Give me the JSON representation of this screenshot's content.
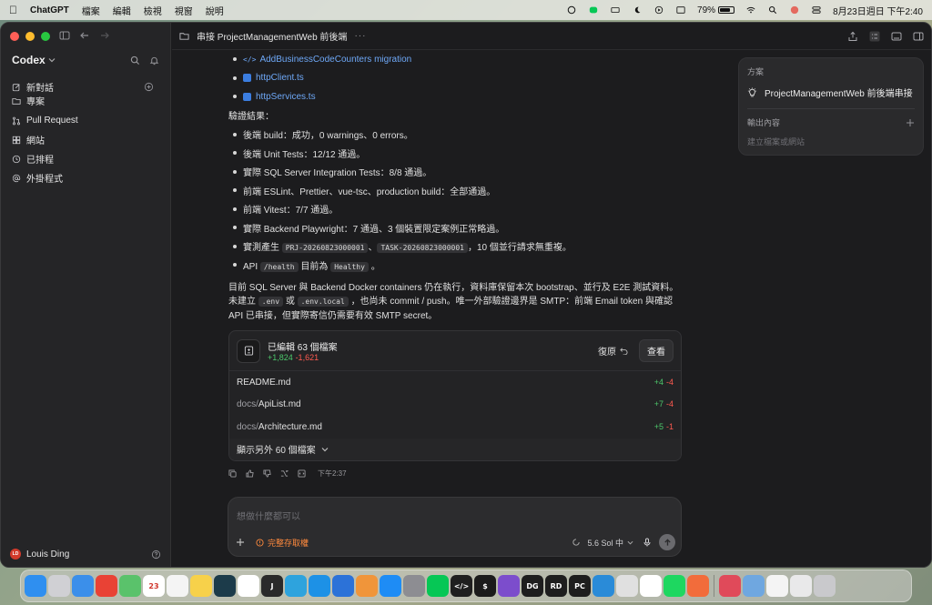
{
  "menubar": {
    "app_name": "ChatGPT",
    "menus": [
      "檔案",
      "編輯",
      "檢視",
      "視窗",
      "說明"
    ],
    "battery": "79%",
    "battery_level": 0.79,
    "datetime": "8月23日週日 下午2:40"
  },
  "sidebar": {
    "title": "Codex",
    "items": [
      {
        "label": "新對話",
        "icon": "compose-icon"
      },
      {
        "label": "專案",
        "icon": "folder-icon"
      },
      {
        "label": "Pull Request",
        "icon": "pull-request-icon"
      },
      {
        "label": "網站",
        "icon": "grid-icon"
      },
      {
        "label": "已排程",
        "icon": "clock-icon"
      },
      {
        "label": "外掛程式",
        "icon": "at-icon"
      }
    ],
    "user": {
      "name": "Louis Ding",
      "initials": "LD"
    }
  },
  "topbar": {
    "title": "串接 ProjectManagementWeb 前後端",
    "more": "···"
  },
  "conversation": {
    "files": [
      {
        "name": "AddBusinessCodeCounters migration",
        "kind": "code"
      },
      {
        "name": "httpClient.ts",
        "kind": "ts"
      },
      {
        "name": "httpServices.ts",
        "kind": "ts"
      }
    ],
    "verify_label": "驗證結果：",
    "results": [
      {
        "text": "後端 build：成功，0 warnings、0 errors。"
      },
      {
        "text": "後端 Unit Tests：12/12 通過。"
      },
      {
        "text": "實際 SQL Server Integration Tests：8/8 通過。"
      },
      {
        "text": "前端 ESLint、Prettier、vue-tsc、production build：全部通過。"
      },
      {
        "text": "前端 Vitest：7/7 通過。"
      },
      {
        "text": "實際 Backend Playwright：7 通過、3 個裝置限定案例正常略過。"
      }
    ],
    "result_codes": {
      "prefix": "實測產生",
      "code1": "PRJ-20260823000001",
      "sep": "、",
      "code2": "TASK-20260823000001",
      "suffix": "，10 個並行請求無重複。"
    },
    "result_api": {
      "prefix": "API",
      "code1": "/health",
      "mid": "目前為",
      "code2": "Healthy",
      "suffix": "。"
    },
    "paragraph": {
      "part1": "目前 SQL Server 與 Backend Docker containers 仍在執行，資料庫保留本次 bootstrap、並行及 E2E 測試資料。未建立",
      "code1": ".env",
      "part2": "或",
      "code2": ".env.local",
      "part3": "，也尚未 commit / push。唯一外部驗證邊界是 SMTP：前端 Email token 與確認 API 已串接，但實際寄信仍需要有效 SMTP secret。"
    },
    "card": {
      "title": "已編輯 63 個檔案",
      "additions": "+1,824",
      "deletions": "-1,621",
      "restore": "復原",
      "view": "查看",
      "files": [
        {
          "dir": "",
          "name": "README.md",
          "add": "+4",
          "del": "-4"
        },
        {
          "dir": "docs/",
          "name": "ApiList.md",
          "add": "+7",
          "del": "-4"
        },
        {
          "dir": "docs/",
          "name": "Architecture.md",
          "add": "+5",
          "del": "-1"
        }
      ],
      "show_more": "顯示另外 60 個檔案"
    },
    "timestamp": "下午2:37"
  },
  "composer": {
    "placeholder": "想做什麼都可以",
    "permission": "完整存取權",
    "model": "5.6 Sol 中"
  },
  "right_panel": {
    "plan_label": "方案",
    "plan_item": "ProjectManagementWeb 前後端串接",
    "output_label": "輸出內容",
    "output_hint": "建立檔案或網站"
  },
  "dock": {
    "apps": [
      {
        "name": "Finder",
        "color": "#2f8ff0",
        "glyph": ""
      },
      {
        "name": "Launchpad",
        "color": "#d0d0d4",
        "glyph": ""
      },
      {
        "name": "Mail",
        "color": "#3b8fea",
        "glyph": ""
      },
      {
        "name": "Chrome",
        "color": "#e94235",
        "glyph": ""
      },
      {
        "name": "Maps",
        "color": "#5ac26b",
        "glyph": ""
      },
      {
        "name": "Calendar",
        "color": "#ffffff",
        "glyph": "23"
      },
      {
        "name": "Reminders",
        "color": "#f4f4f4",
        "glyph": ""
      },
      {
        "name": "Notes",
        "color": "#f7d14a",
        "glyph": ""
      },
      {
        "name": "Stocks",
        "color": "#1c3b4a",
        "glyph": ""
      },
      {
        "name": "Home",
        "color": "#ffffff",
        "glyph": ""
      },
      {
        "name": "J",
        "color": "#2a2a2a",
        "glyph": "J"
      },
      {
        "name": "Telegram",
        "color": "#2ea3dd",
        "glyph": ""
      },
      {
        "name": "Docker",
        "color": "#1d91e6",
        "glyph": ""
      },
      {
        "name": "App",
        "color": "#2c72d8",
        "glyph": ""
      },
      {
        "name": "Sublime",
        "color": "#f0953a",
        "glyph": ""
      },
      {
        "name": "App Store",
        "color": "#1e8cf5",
        "glyph": ""
      },
      {
        "name": "Settings",
        "color": "#8d8d92",
        "glyph": ""
      },
      {
        "name": "LINE",
        "color": "#06c755",
        "glyph": ""
      },
      {
        "name": "Code",
        "color": "#1f1f1f",
        "glyph": "</>"
      },
      {
        "name": "Terminal",
        "color": "#1b1b1b",
        "glyph": "$"
      },
      {
        "name": "Obsidian",
        "color": "#7c4dcc",
        "glyph": ""
      },
      {
        "name": "DataGrip",
        "color": "#1e1e1e",
        "glyph": "DG"
      },
      {
        "name": "Rider",
        "color": "#1e1e1e",
        "glyph": "RD"
      },
      {
        "name": "PyCharm",
        "color": "#1e1e1e",
        "glyph": "PC"
      },
      {
        "name": "VS Code",
        "color": "#2a8bd8",
        "glyph": ""
      },
      {
        "name": "Preview",
        "color": "#e0e0e0",
        "glyph": ""
      },
      {
        "name": "ChatGPT",
        "color": "#ffffff",
        "glyph": ""
      },
      {
        "name": "Spotify",
        "color": "#1ed760",
        "glyph": ""
      },
      {
        "name": "Pencil",
        "color": "#f26c3b",
        "glyph": ""
      },
      {
        "name": "Pixelmator",
        "color": "#e04a5a",
        "glyph": ""
      },
      {
        "name": "Disk",
        "color": "#6fa7e0",
        "glyph": ""
      },
      {
        "name": "TextEdit",
        "color": "#f4f4f4",
        "glyph": ""
      },
      {
        "name": "Downloads",
        "color": "#e9e9ea",
        "glyph": ""
      },
      {
        "name": "Trash",
        "color": "#c9c9cc",
        "glyph": ""
      }
    ]
  }
}
